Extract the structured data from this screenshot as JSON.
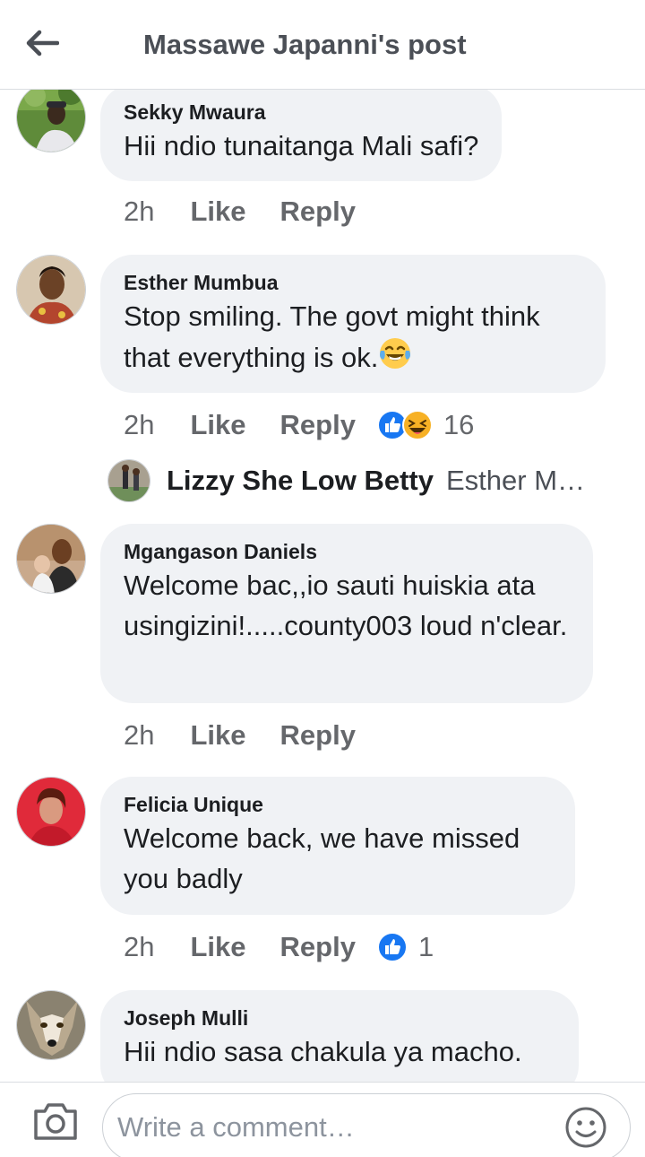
{
  "header": {
    "title": "Massawe Japanni's post",
    "back_icon": "back-arrow-icon"
  },
  "comments": [
    {
      "author": "Sekky Mwaura",
      "text": "Hii ndio tunaitanga Mali safi?",
      "time": "2h",
      "like": "Like",
      "reply": "Reply"
    },
    {
      "author": "Esther Mumbua",
      "text": "Stop smiling. The govt might think that everything is ok.",
      "emoji": "tears-of-joy-emoji",
      "time": "2h",
      "like": "Like",
      "reply": "Reply",
      "reaction_count": "16",
      "reaction_icons": [
        "like-reaction-icon",
        "laugh-reaction-icon"
      ]
    },
    {
      "author": "Mgangason Daniels",
      "text": "Welcome bac,,io sauti huiskia ata usingizini!.....county003 loud n'clear.",
      "time": "2h",
      "like": "Like",
      "reply": "Reply"
    },
    {
      "author": "Felicia Unique",
      "text": "Welcome back, we have missed you badly",
      "time": "2h",
      "like": "Like",
      "reply": "Reply",
      "reaction_count": "1",
      "reaction_icons": [
        "like-reaction-icon"
      ]
    },
    {
      "author": "Joseph Mulli",
      "text": "Hii ndio sasa chakula ya macho."
    }
  ],
  "reply_preview": {
    "name": "Lizzy She Low Betty",
    "text": "Esther M…"
  },
  "composer": {
    "placeholder": "Write a comment…",
    "camera_icon": "camera-icon",
    "emoji_icon": "smiley-icon"
  },
  "colors": {
    "bubble": "#f0f2f5",
    "meta_text": "#65676b",
    "like_blue": "#1877f2",
    "laugh_yellow": "#f7b125"
  }
}
